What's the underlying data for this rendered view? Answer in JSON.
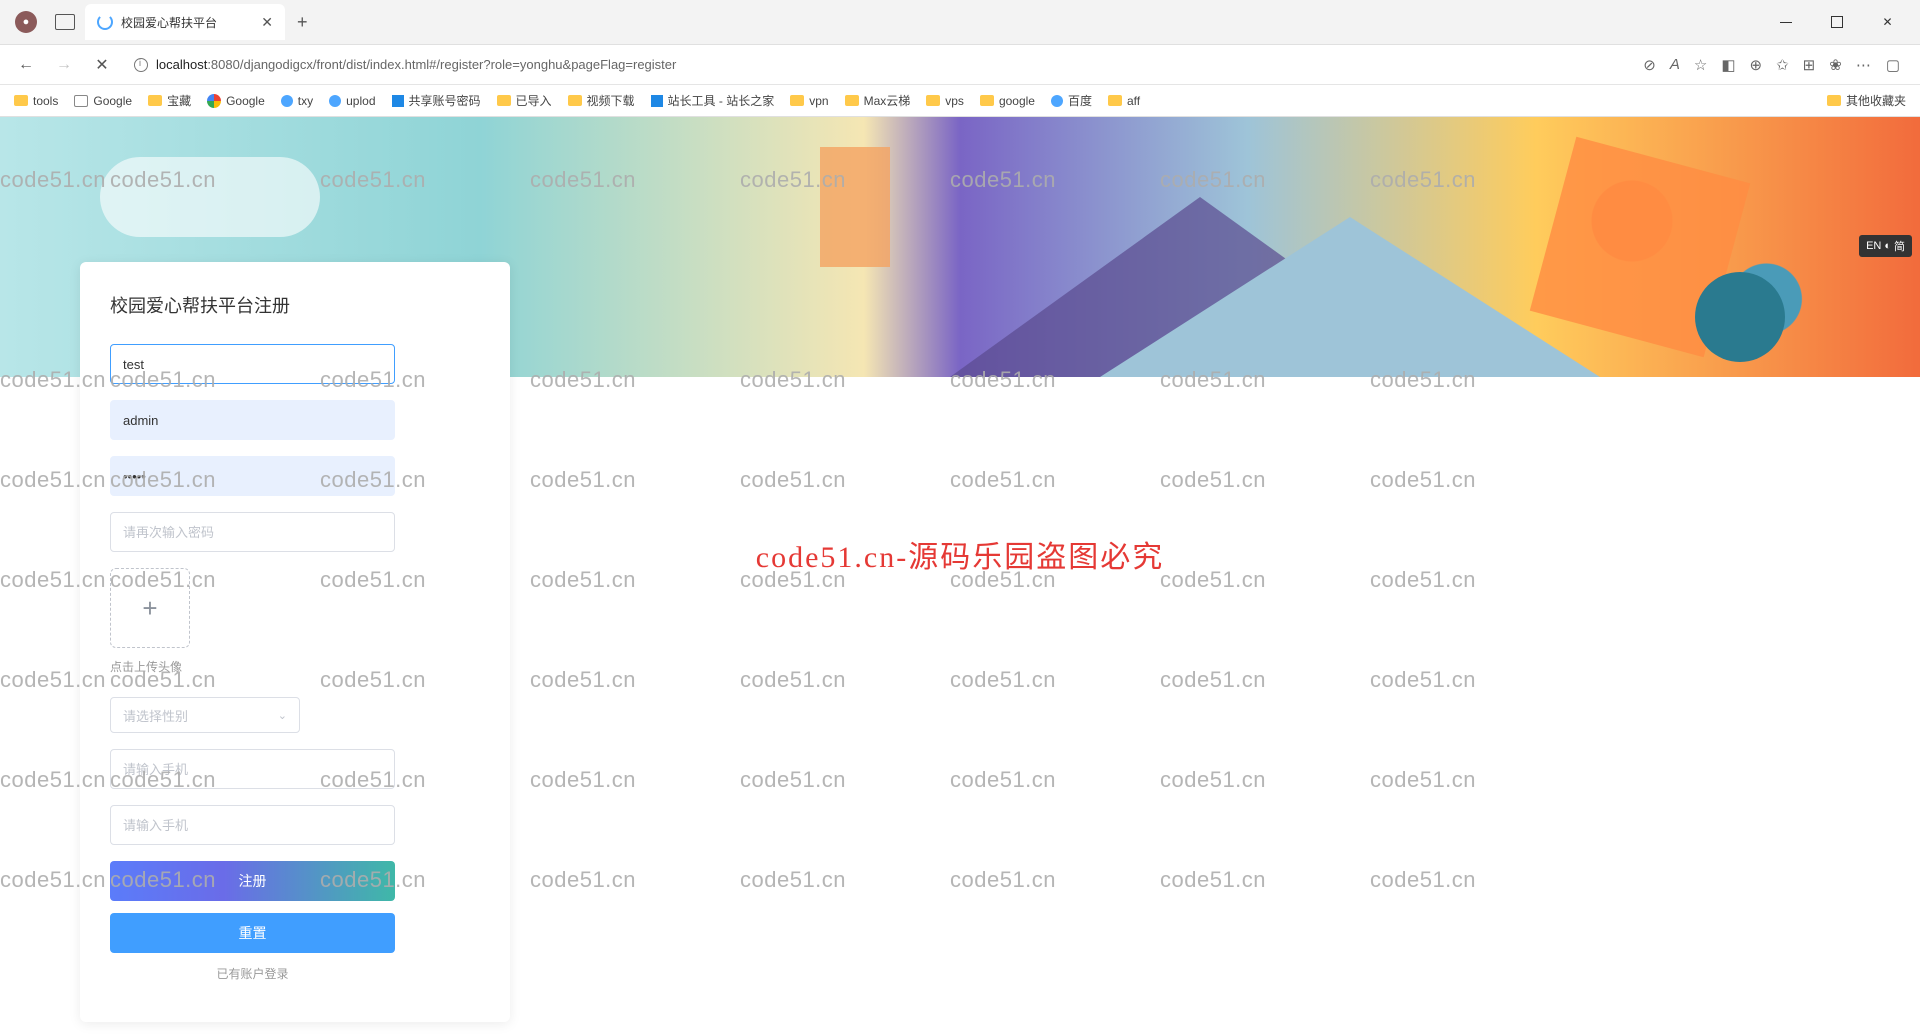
{
  "browser": {
    "tab_title": "校园爱心帮扶平台",
    "url_host": "localhost",
    "url_port": ":8080",
    "url_path": "/djangodigcx/front/dist/index.html#/register?role=yonghu&pageFlag=register",
    "bookmarks": [
      "tools",
      "Google",
      "宝藏",
      "Google",
      "txy",
      "uplod",
      "共享账号密码",
      "已导入",
      "视频下载",
      "站长工具 - 站长之家",
      "vpn",
      "Max云梯",
      "vps",
      "google",
      "百度",
      "aff"
    ],
    "other_bookmarks": "其他收藏夹"
  },
  "form": {
    "title": "校园爱心帮扶平台注册",
    "username_value": "test",
    "account_value": "admin",
    "password_value": "•••••",
    "confirm_placeholder": "请再次输入密码",
    "upload_hint": "点击上传头像",
    "gender_placeholder": "请选择性别",
    "phone1_placeholder": "请输入手机",
    "phone2_placeholder": "请输入手机",
    "submit": "注册",
    "reset": "重置",
    "login_link": "已有账户登录"
  },
  "watermark": {
    "small": "code51.cn",
    "big": "code51.cn-源码乐园盗图必究"
  },
  "ime": {
    "lang": "EN",
    "mode": "简"
  }
}
